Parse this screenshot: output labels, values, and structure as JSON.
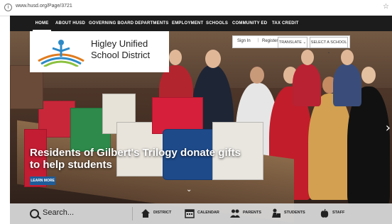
{
  "browser": {
    "url": "www.husd.org/Page/3721"
  },
  "nav": {
    "items": [
      "HOME",
      "ABOUT HUSD",
      "GOVERNING BOARD",
      "DEPARTMENTS",
      "EMPLOYMENT",
      "SCHOOLS",
      "COMMUNITY ED",
      "TAX CREDIT"
    ]
  },
  "logo": {
    "line1": "Higley Unified",
    "line2": "School District"
  },
  "account": {
    "sign_in": "Sign In",
    "separator": "|",
    "register": "Register"
  },
  "dropdowns": {
    "translate": "TRANSLATE",
    "select_school": "SELECT A SCHOOL"
  },
  "hero": {
    "headline_line1": "Residents of Gilbert's Trilogy donate gifts",
    "headline_line2": "to help students",
    "learn_more": "LEARN MORE"
  },
  "quicklinks": {
    "search_placeholder": "Search...",
    "items": [
      "DISTRICT",
      "CALENDAR",
      "PARENTS",
      "STUDENTS",
      "STAFF"
    ]
  },
  "colors": {
    "nav_bg": "#1c1c1c",
    "learn_more_bg": "#1f5d9a",
    "bottom_bar": "#d7d7d7"
  }
}
